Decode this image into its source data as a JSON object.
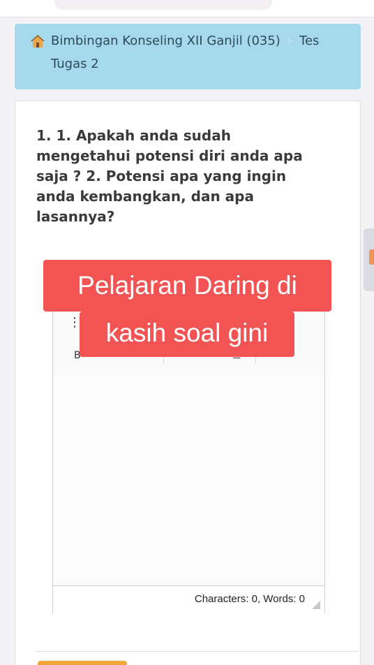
{
  "breadcrumb": {
    "course": "Bimbingan Konseling XII Ganjil (035)",
    "separator": "›",
    "section": "Tes",
    "item": "Tugas 2"
  },
  "question": {
    "text": "1. 1. Apakah anda sudah mengetahui potensi diri anda apa saja ? 2. Potensi apa yang ingin anda kembangkan, dan apa lasannya?"
  },
  "editor": {
    "toolbar_partial": "B",
    "status": "Characters: 0, Words: 0"
  },
  "overlay": {
    "line1": "Pelajaran Daring di",
    "line2": "kasih soal gini"
  },
  "colors": {
    "breadcrumb_bg": "#a6d9ec",
    "caption_bg": "#f25454",
    "button_accent": "#f0a63a"
  }
}
